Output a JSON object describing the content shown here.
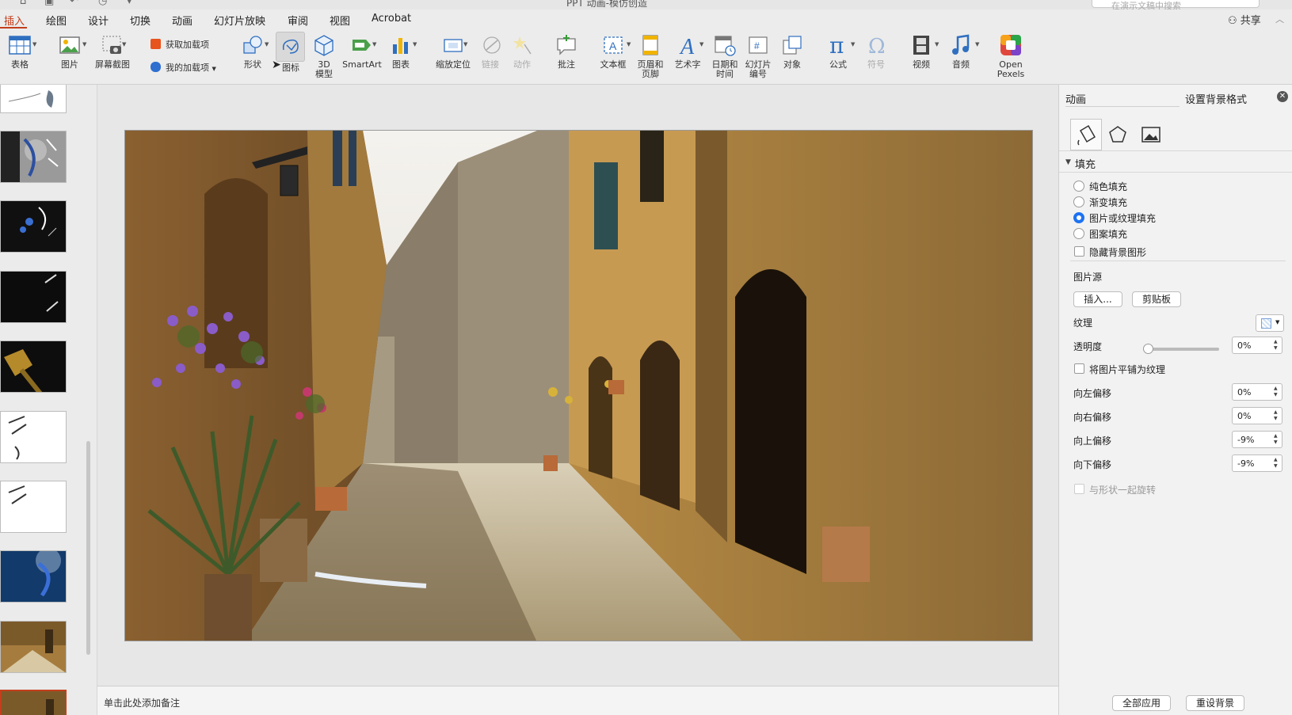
{
  "title_bar": {
    "doc_title": "PPT 动画-模仿创造",
    "search_placeholder": "在演示文稿中搜索"
  },
  "tabs": [
    {
      "label": "插入",
      "active": true
    },
    {
      "label": "绘图"
    },
    {
      "label": "设计"
    },
    {
      "label": "切换"
    },
    {
      "label": "动画"
    },
    {
      "label": "幻灯片放映"
    },
    {
      "label": "审阅"
    },
    {
      "label": "视图"
    },
    {
      "label": "Acrobat"
    }
  ],
  "share_label": "共享",
  "ribbon": {
    "table": "表格",
    "picture": "图片",
    "screenshot": "屏幕截图",
    "get_addins": "获取加载项",
    "my_addins": "我的加载项",
    "shapes": "形状",
    "icons": "图标",
    "model_3d_1": "3D",
    "model_3d_2": "模型",
    "smartart": "SmartArt",
    "chart": "图表",
    "zoom": "缩放定位",
    "link": "链接",
    "action": "动作",
    "comment": "批注",
    "textbox": "文本框",
    "header_1": "页眉和",
    "header_2": "页脚",
    "wordart": "艺术字",
    "datetime_1": "日期和",
    "datetime_2": "时间",
    "slidenum_1": "幻灯片",
    "slidenum_2": "编号",
    "object": "对象",
    "equation": "公式",
    "symbol": "符号",
    "video": "视频",
    "audio": "音频",
    "pexels_1": "Open",
    "pexels_2": "Pexels"
  },
  "notes_placeholder": "单击此处添加备注",
  "panel": {
    "tab_animation": "动画",
    "tab_format_bg": "设置背景格式",
    "fill_section": "填充",
    "fill_options": [
      {
        "label": "纯色填充",
        "selected": false
      },
      {
        "label": "渐变填充",
        "selected": false
      },
      {
        "label": "图片或纹理填充",
        "selected": true
      },
      {
        "label": "图案填充",
        "selected": false
      }
    ],
    "hide_bg_graphics": "隐藏背景图形",
    "picture_source": "图片源",
    "insert_button": "插入...",
    "clipboard_button": "剪贴板",
    "texture_label": "纹理",
    "transparency_label": "透明度",
    "transparency_value": "0%",
    "transparency_level": 0,
    "tile_picture": "将图片平铺为纹理",
    "offsets": [
      {
        "label": "向左偏移",
        "value": "0%"
      },
      {
        "label": "向右偏移",
        "value": "0%"
      },
      {
        "label": "向上偏移",
        "value": "-9%"
      },
      {
        "label": "向下偏移",
        "value": "-9%"
      }
    ],
    "rotate_with_shape": "与形状一起旋转",
    "apply_all": "全部应用",
    "reset_bg": "重设背景"
  },
  "colors": {
    "accent": "#c43e1c",
    "radio_on": "#1d72f3"
  }
}
